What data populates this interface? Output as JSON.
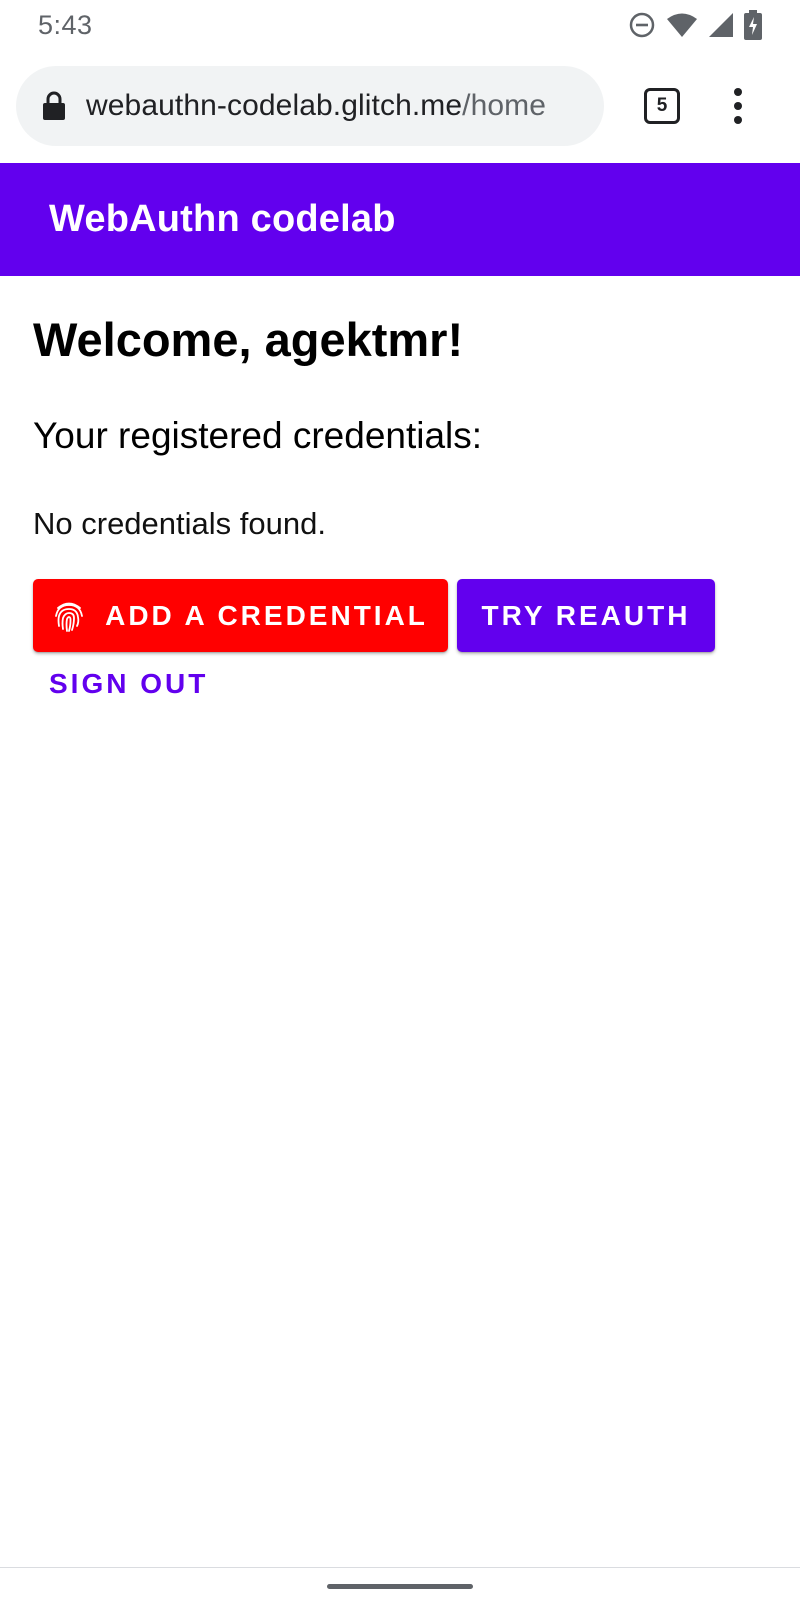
{
  "status_bar": {
    "time": "5:43",
    "icons": [
      "do-not-disturb-icon",
      "wifi-icon",
      "cell-signal-icon",
      "battery-charging-icon"
    ]
  },
  "browser": {
    "url_host": "webauthn-codelab.glitch.me",
    "url_path": "/home",
    "tab_count": "5",
    "icons": [
      "lock-icon",
      "more-vert-icon"
    ]
  },
  "app_bar": {
    "title": "WebAuthn codelab",
    "color": "#6200ee"
  },
  "main": {
    "welcome": "Welcome, agektmr!",
    "credentials_heading": "Your registered credentials:",
    "empty_message": "No credentials found.",
    "add_credential_label": "ADD A CREDENTIAL",
    "add_credential_icon": "fingerprint-icon",
    "add_credential_color": "#ff0000",
    "reauth_label": "TRY REAUTH",
    "reauth_color": "#6200ee",
    "sign_out_label": "SIGN OUT"
  }
}
